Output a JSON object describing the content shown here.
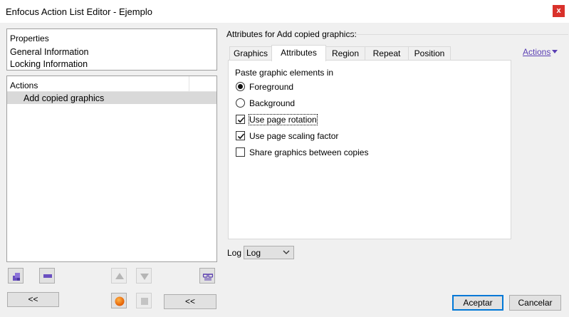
{
  "window": {
    "title": "Enfocus Action List Editor - Ejemplo",
    "close_label": "x"
  },
  "properties": {
    "header": "Properties",
    "items": [
      {
        "label": "General Information"
      },
      {
        "label": "Locking Information"
      }
    ]
  },
  "actions_list": {
    "header": "Actions",
    "items": [
      {
        "label": "Add copied graphics",
        "selected": true
      }
    ]
  },
  "left_buttons": {
    "collapse_label": "<<",
    "collapse2_label": "<<",
    "icons": [
      "add-action-icon",
      "remove-action-icon",
      "move-up-icon",
      "move-down-icon",
      "preview-glasses-icon",
      "record-icon",
      "stop-icon"
    ]
  },
  "attributes": {
    "title": "Attributes for Add copied graphics:",
    "tabs": [
      {
        "label": "Graphics",
        "active": false
      },
      {
        "label": "Attributes",
        "active": true
      },
      {
        "label": "Region",
        "active": false
      },
      {
        "label": "Repeat",
        "active": false
      },
      {
        "label": "Position",
        "active": false
      }
    ],
    "actions_menu_label": "Actions",
    "paste_legend": "Paste graphic elements in",
    "radios": [
      {
        "label": "Foreground",
        "checked": true
      },
      {
        "label": "Background",
        "checked": false
      }
    ],
    "checkboxes": [
      {
        "label": "Use page rotation",
        "checked": true
      },
      {
        "label": "Use page scaling factor",
        "checked": true
      },
      {
        "label": "Share graphics between copies",
        "checked": false
      }
    ]
  },
  "log": {
    "label": "Log",
    "value": "Log"
  },
  "footer": {
    "ok_label": "Aceptar",
    "cancel_label": "Cancelar"
  },
  "colors": {
    "accent": "#0078d7",
    "close_button": "#d9312b",
    "link": "#5a3fb3",
    "selection": "#d9d9d9"
  }
}
